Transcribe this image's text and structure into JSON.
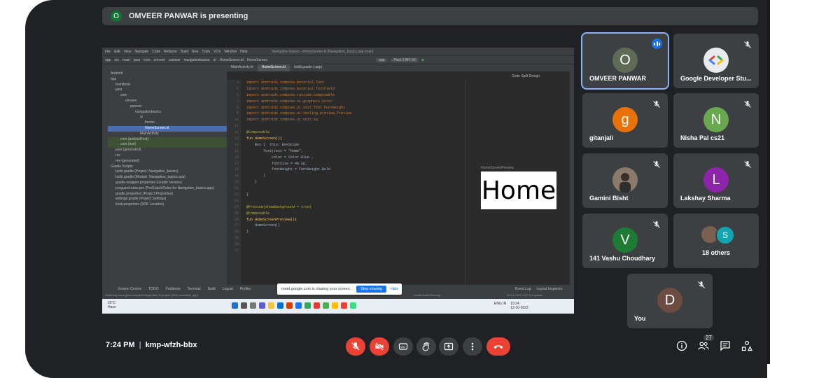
{
  "presenting": {
    "avatar_initial": "O",
    "text": "OMVEER PANWAR is presenting"
  },
  "ide": {
    "menu": [
      "File",
      "Edit",
      "View",
      "Navigate",
      "Code",
      "Refactor",
      "Build",
      "Run",
      "Tools",
      "VCS",
      "Window",
      "Help"
    ],
    "window_title": "Navigation basics - HomeScreen.kt [Navigation_basics.app.main]",
    "breadcrumb": [
      "app",
      "src",
      "main",
      "java",
      "com",
      "omveer",
      "panwar",
      "navigationbasics",
      "ui",
      "HomeScreen.kt",
      "HomeScreen"
    ],
    "device": "Pixel 2 API 30",
    "run_config": "app",
    "tabs": [
      "MainActivity.kt",
      "HomeScreen.kt",
      "build.gradle (:app)"
    ],
    "view_modes": [
      "Code",
      "Split",
      "Design"
    ],
    "project_tree": [
      {
        "depth": 0,
        "label": "Android",
        "state": ""
      },
      {
        "depth": 0,
        "label": "app",
        "state": ""
      },
      {
        "depth": 1,
        "label": "manifests",
        "state": ""
      },
      {
        "depth": 1,
        "label": "java",
        "state": ""
      },
      {
        "depth": 2,
        "label": "com",
        "state": ""
      },
      {
        "depth": 3,
        "label": "omveer",
        "state": ""
      },
      {
        "depth": 4,
        "label": "panwar",
        "state": ""
      },
      {
        "depth": 5,
        "label": "navigationbasics",
        "state": ""
      },
      {
        "depth": 6,
        "label": "ui",
        "state": ""
      },
      {
        "depth": 7,
        "label": "theme",
        "state": ""
      },
      {
        "depth": 7,
        "label": "HomeScreen.kt",
        "state": "sel"
      },
      {
        "depth": 6,
        "label": "MainActivity",
        "state": ""
      },
      {
        "depth": 2,
        "label": "com (androidTest)",
        "state": "hl"
      },
      {
        "depth": 2,
        "label": "com (test)",
        "state": "hl"
      },
      {
        "depth": 1,
        "label": "java (generated)",
        "state": ""
      },
      {
        "depth": 1,
        "label": "res",
        "state": ""
      },
      {
        "depth": 1,
        "label": "res (generated)",
        "state": ""
      },
      {
        "depth": 0,
        "label": "Gradle Scripts",
        "state": ""
      },
      {
        "depth": 1,
        "label": "build.gradle (Project: Navigation_basics)",
        "state": ""
      },
      {
        "depth": 1,
        "label": "build.gradle (Module: Navigation_basics.app)",
        "state": ""
      },
      {
        "depth": 1,
        "label": "gradle-wrapper.properties (Gradle Version)",
        "state": ""
      },
      {
        "depth": 1,
        "label": "proguard-rules.pro (ProGuard Rules for Navigation_basics.app)",
        "state": ""
      },
      {
        "depth": 1,
        "label": "gradle.properties (Project Properties)",
        "state": ""
      },
      {
        "depth": 1,
        "label": "settings.gradle (Project Settings)",
        "state": ""
      },
      {
        "depth": 1,
        "label": "local.properties (SDK Location)",
        "state": ""
      }
    ],
    "line_numbers": [
      "4",
      "5",
      "6",
      "7",
      "8",
      "9",
      "10",
      "11",
      "12",
      "13",
      "14",
      "15",
      "16",
      "17",
      "18",
      "19",
      "20",
      "21",
      "22",
      "23",
      "24",
      "25",
      "26",
      "27",
      "28",
      "29",
      "30",
      "31"
    ],
    "code_lines": [
      "import androidx.compose.material.Text",
      "import androidx.compose.material.TextField",
      "import androidx.compose.runtime.Composable",
      "import androidx.compose.ui.graphics.Color",
      "import androidx.compose.ui.text.font.FontWeight",
      "import androidx.compose.ui.tooling.preview.Preview",
      "import androidx.compose.ui.unit.sp",
      "",
      "@Composable",
      "fun HomeScreen(){",
      "    Box {  this: BoxScope",
      "        Text(text = \"Home\",",
      "            color = Color.Blue ,",
      "            fontSize = 40.sp,",
      "            fontWeight = FontWeight.Bold",
      "        )",
      "    }",
      "",
      "}",
      "",
      "@Preview(showBackground = true)",
      "@Composable",
      "fun HomeScreenPreview(){",
      "    HomeScreen()",
      "}",
      "",
      "",
      ""
    ],
    "preview_label": "HomeScreenPreview",
    "preview_text": "Home",
    "bottom_tabs": [
      "Version Control",
      "TODO",
      "Problems",
      "Terminal",
      "Build",
      "Logcat",
      "Profiler"
    ],
    "bottom_right_tabs": [
      "Event Log",
      "Layout Inspector"
    ],
    "status_text": "Switching focus (java.compileDebugKotlin) to project (SHA: maomete_app)",
    "status_right": "Gradle Build Running",
    "status_position": "10:12  CRLF  UTF-8  4 spaces",
    "share_bar": {
      "message": "meet.google.com is sharing your screen.",
      "stop": "Stop sharing",
      "hide": "Hide"
    },
    "taskbar": {
      "temp": "26°C",
      "weather": "Haze",
      "lang": "ENG IN",
      "time": "19:24",
      "date": "12-10-2022"
    }
  },
  "participants": [
    {
      "name": "OMVEER PANWAR",
      "initial": "O",
      "color": "#5f6b54",
      "speaking": true,
      "muted": false
    },
    {
      "name": "Google Developer Stu...",
      "initial": "",
      "color": "#e8eaed",
      "speaking": false,
      "muted": true
    },
    {
      "name": "gitanjali",
      "initial": "g",
      "color": "#e8710a",
      "speaking": false,
      "muted": true
    },
    {
      "name": "Nisha Pal cs21",
      "initial": "N",
      "color": "#6aa84f",
      "speaking": false,
      "muted": true
    },
    {
      "name": "Gamini Bisht",
      "initial": "",
      "color": "#6b5b4b",
      "speaking": false,
      "muted": true
    },
    {
      "name": "Lakshay Sharma",
      "initial": "L",
      "color": "#8e24aa",
      "speaking": false,
      "muted": true
    },
    {
      "name": "141 Vashu Choudhary",
      "initial": "V",
      "color": "#1e7b34",
      "speaking": false,
      "muted": true
    },
    {
      "name": "18 others",
      "initial": "S",
      "color": "#12a4af",
      "speaking": false,
      "muted": false
    },
    {
      "name": "You",
      "initial": "D",
      "color": "#6d4c41",
      "speaking": false,
      "muted": true
    }
  ],
  "meeting": {
    "time": "7:24 PM",
    "code": "kmp-wfzh-bbx",
    "people_count": "27"
  }
}
